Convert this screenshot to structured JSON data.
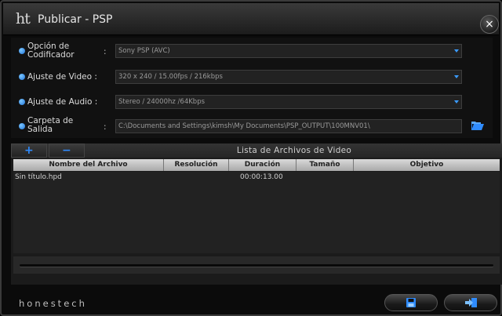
{
  "window": {
    "logo_text": "ht",
    "title": "Publicar  - PSP",
    "close_glyph": "×"
  },
  "settings": {
    "encoder": {
      "label_line1": "Opción de",
      "label_line2": "Codificador",
      "separator": ":",
      "value": "Sony PSP (AVC)"
    },
    "video": {
      "label": "Ajuste de Video :",
      "value": "320 x 240 / 15.00fps / 216kbps"
    },
    "audio": {
      "label": "Ajuste de Audio :",
      "value": "Stereo / 24000hz /64Kbps"
    },
    "output": {
      "label_line1": "Carpeta de",
      "label_line2": "Salida",
      "separator": ":",
      "value": "C:\\Documents and Settings\\kimsh\\My Documents\\PSP_OUTPUT\\100MNV01\\"
    }
  },
  "file_list": {
    "add_glyph": "+",
    "remove_glyph": "−",
    "title": "Lista de Archivos de Video",
    "columns": [
      "Nombre del Archivo",
      "Resolución",
      "Duración",
      "Tamaño",
      "Objetivo"
    ],
    "rows": [
      {
        "name": "Sin título.hpd",
        "resolution": "",
        "duration": "00:00:13.00",
        "size": "",
        "target": ""
      }
    ]
  },
  "footer": {
    "brand": "honestech",
    "save_icon": "save-icon",
    "publish_icon": "publish-icon"
  },
  "colors": {
    "accent": "#2f8cff",
    "background": "#0b0b0b"
  }
}
